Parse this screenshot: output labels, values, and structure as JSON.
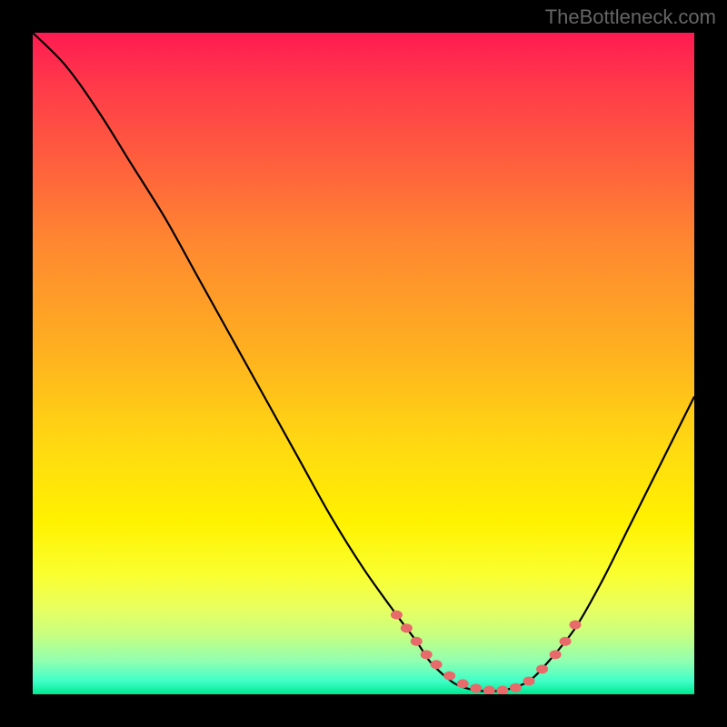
{
  "watermark": "TheBottleneck.com",
  "chart_data": {
    "type": "line",
    "title": "",
    "xlabel": "",
    "ylabel": "",
    "xlim": [
      0,
      100
    ],
    "ylim": [
      0,
      100
    ],
    "series": [
      {
        "name": "bottleneck-curve",
        "x": [
          0,
          5,
          10,
          15,
          20,
          25,
          30,
          35,
          40,
          45,
          50,
          55,
          58,
          60,
          62,
          64,
          66,
          68,
          70,
          72,
          75,
          78,
          82,
          86,
          90,
          95,
          100
        ],
        "y": [
          100,
          95,
          88,
          80,
          72,
          63,
          54,
          45,
          36,
          27,
          19,
          12,
          8,
          5,
          3,
          1.5,
          0.8,
          0.5,
          0.5,
          0.8,
          2,
          5,
          10,
          17,
          25,
          35,
          45
        ]
      }
    ],
    "markers": {
      "name": "highlight-points",
      "color": "#e86a6a",
      "x": [
        55,
        56.5,
        58,
        59.5,
        61,
        63,
        65,
        67,
        69,
        71,
        73,
        75,
        77,
        79,
        80.5,
        82
      ],
      "y": [
        12,
        10,
        8,
        6,
        4.5,
        2.8,
        1.6,
        0.9,
        0.6,
        0.6,
        1,
        2,
        3.8,
        6,
        8,
        10.5
      ]
    },
    "gradient_stops": [
      {
        "pos": 0,
        "color": "#ff1a52"
      },
      {
        "pos": 50,
        "color": "#ffd000"
      },
      {
        "pos": 85,
        "color": "#f8ff40"
      },
      {
        "pos": 100,
        "color": "#00e890"
      }
    ]
  }
}
